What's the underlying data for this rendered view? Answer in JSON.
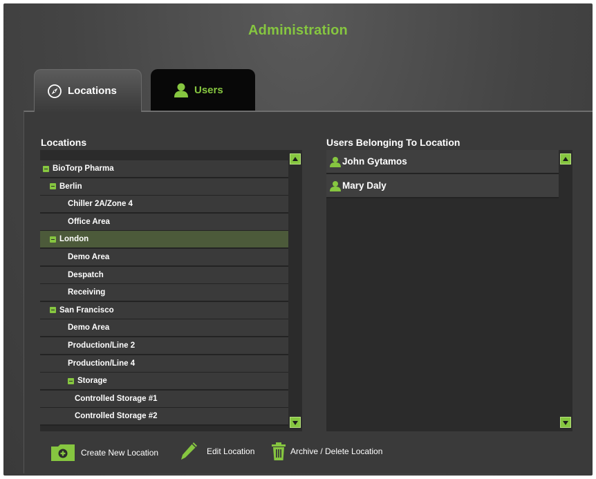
{
  "header": {
    "title": "Administration"
  },
  "tabs": [
    {
      "label": "Locations",
      "icon": "compass-icon",
      "active": true
    },
    {
      "label": "Users",
      "icon": "user-icon",
      "active": false
    }
  ],
  "locations_panel": {
    "label": "Locations",
    "items": [
      {
        "label": "BioTorp Pharma",
        "level": 0,
        "expanded": true
      },
      {
        "label": "Berlin",
        "level": 1,
        "expanded": true
      },
      {
        "label": "Chiller 2A/Zone 4",
        "level": 2
      },
      {
        "label": "Office Area",
        "level": 2
      },
      {
        "label": "London",
        "level": 1,
        "expanded": true,
        "selected": true
      },
      {
        "label": "Demo Area",
        "level": 2
      },
      {
        "label": "Despatch",
        "level": 2
      },
      {
        "label": "Receiving",
        "level": 2
      },
      {
        "label": "San Francisco",
        "level": 1,
        "expanded": true
      },
      {
        "label": "Demo Area",
        "level": 2
      },
      {
        "label": "Production/Line 2",
        "level": 2
      },
      {
        "label": "Production/Line 4",
        "level": 2
      },
      {
        "label": "Storage",
        "level": 2,
        "expanded": true
      },
      {
        "label": "Controlled Storage #1",
        "level": 3
      },
      {
        "label": "Controlled Storage #2",
        "level": 3
      }
    ]
  },
  "users_panel": {
    "label": "Users Belonging To Location",
    "users": [
      {
        "name": "John Gytamos"
      },
      {
        "name": "Mary Daly"
      }
    ]
  },
  "actions": {
    "create": "Create New Location",
    "edit": "Edit Location",
    "archive": "Archive / Delete Location"
  },
  "colors": {
    "accent": "#86c640",
    "background": "#444444",
    "row": "#3a3a3a",
    "selected_row": "#4c5a3a"
  }
}
